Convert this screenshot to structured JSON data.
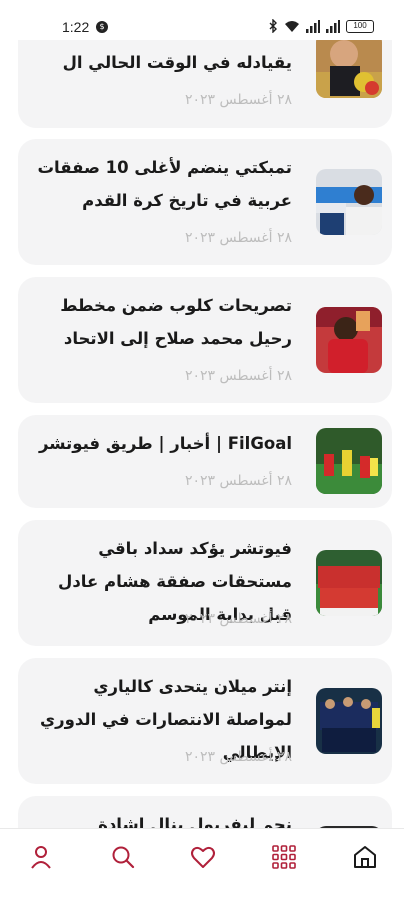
{
  "status_bar": {
    "time": "1:22",
    "battery": "100"
  },
  "articles": [
    {
      "title": "يقيادله في الوقت الحالي ال",
      "date": "٢٨ أغسطس ٢٠٢٣"
    },
    {
      "title": "تمبكتي ينضم لأغلى 10 صفقات عربية في تاريخ كرة القدم",
      "date": "٢٨ أغسطس ٢٠٢٣"
    },
    {
      "title": "تصريحات كلوب ضمن مخطط رحيل محمد صلاح إلى الاتحاد",
      "date": "٢٨ أغسطس ٢٠٢٣"
    },
    {
      "title": "FilGoal | أخبار | طريق فيوتشر",
      "date": "٢٨ أغسطس ٢٠٢٣"
    },
    {
      "title": "فيوتشر يؤكد سداد باقي مستحقات صفقة هشام عادل قبل بداية الموسم",
      "date": "٢٨ أغسطس ٢٠٢٣"
    },
    {
      "title": "إنتر ميلان يتحدى كالياري لمواصلة الانتصارات في الدوري الإيطالي",
      "date": "٢٨ أغسطس ٢٠٢٣"
    },
    {
      "title": "نجم ليفربول ينال إشادة أسطورة الفريق",
      "date": ""
    }
  ],
  "nav": {
    "items": [
      "profile-icon",
      "search-icon",
      "heart-icon",
      "grid-icon",
      "home-icon"
    ],
    "accent": "#b0203a"
  }
}
